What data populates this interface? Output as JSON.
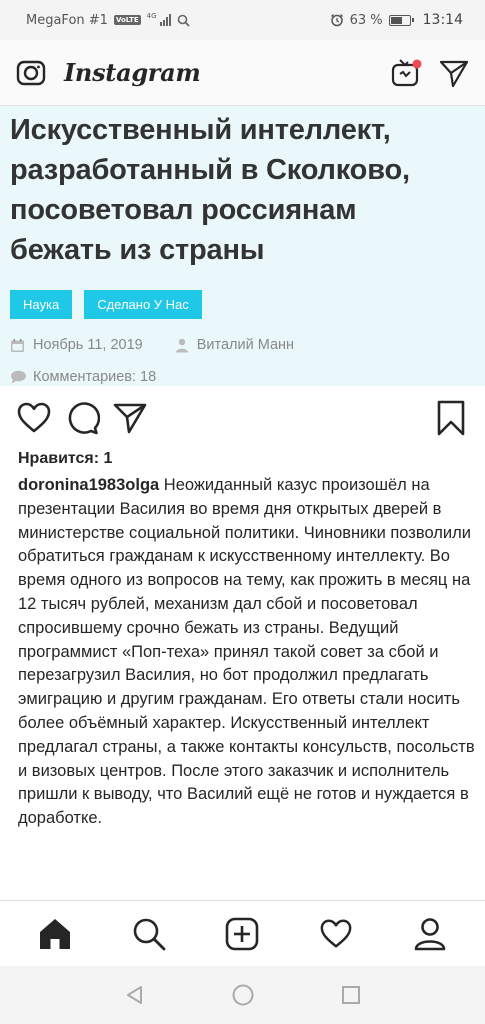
{
  "status_bar": {
    "carrier": "MegaFon #1",
    "volte": "VoLTE",
    "network": "4G",
    "battery": "63 %",
    "battery_level": 0.63,
    "time": "13:14"
  },
  "header": {
    "logo": "Instagram",
    "icons": [
      "camera-icon",
      "igtv-icon",
      "direct-send-icon"
    ]
  },
  "article": {
    "title_lines": [
      "Искусственный интеллект,",
      "разработанный в Сколково,",
      "посоветовал россиянам",
      "бежать из страны"
    ],
    "tags": [
      "Наука",
      "Сделано У Нас"
    ],
    "date": "Ноябрь 11, 2019",
    "author": "Виталий Манн",
    "comments": "Комментариев: 18",
    "background": "#eaf8fb",
    "tag_color": "#1ec8e6"
  },
  "post": {
    "likes": "Нравится: 1",
    "username": "doronina1983olga",
    "caption": "Неожиданный казус произошёл на презентации Василия во время дня открытых дверей в министерстве социальной политики. Чиновники позволили обратиться гражданам к искусственному интеллекту. Во время одного из вопросов на тему, как прожить в месяц на 12 тысяч рублей, механизм дал сбой и посоветовал спросившему срочно бежать из страны. Ведущий программист «Поп-теха» принял такой совет за сбой и перезагрузил Василия, но бот продолжил предлагать эмиграцию и другим гражданам. Его ответы стали носить более объёмный характер. Искусственный интеллект предлагал страны, а также контакты консульств, посольств и визовых центров. После этого заказчик и исполнитель пришли к выводу, что Василий ещё не готов и нуждается в доработке."
  },
  "bottom_nav": [
    "home-icon",
    "search-icon",
    "new-post-icon",
    "activity-heart-icon",
    "profile-icon"
  ],
  "system_nav": [
    "back-icon",
    "home-circle-icon",
    "recents-icon"
  ]
}
